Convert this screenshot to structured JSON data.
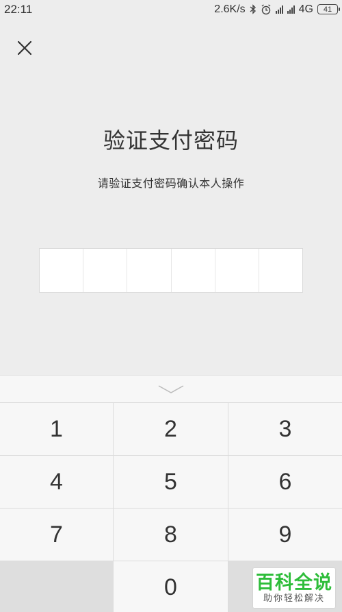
{
  "status_bar": {
    "time": "22:11",
    "network_speed": "2.6K/s",
    "network_type": "4G",
    "battery": "41",
    "icons": [
      "bluetooth-icon",
      "alarm-icon",
      "signal-icon",
      "signal-icon"
    ]
  },
  "header": {
    "close_icon": "close-icon"
  },
  "main": {
    "title": "验证支付密码",
    "subtitle": "请验证支付密码确认本人操作",
    "pin_length": 6
  },
  "keyboard": {
    "hide_icon": "chevron-down-icon",
    "keys": [
      "1",
      "2",
      "3",
      "4",
      "5",
      "6",
      "7",
      "8",
      "9",
      "",
      "0",
      ""
    ]
  },
  "watermark": {
    "main": "百科全说",
    "sub": "助你轻松解决",
    "color": "#2ebd3a"
  }
}
